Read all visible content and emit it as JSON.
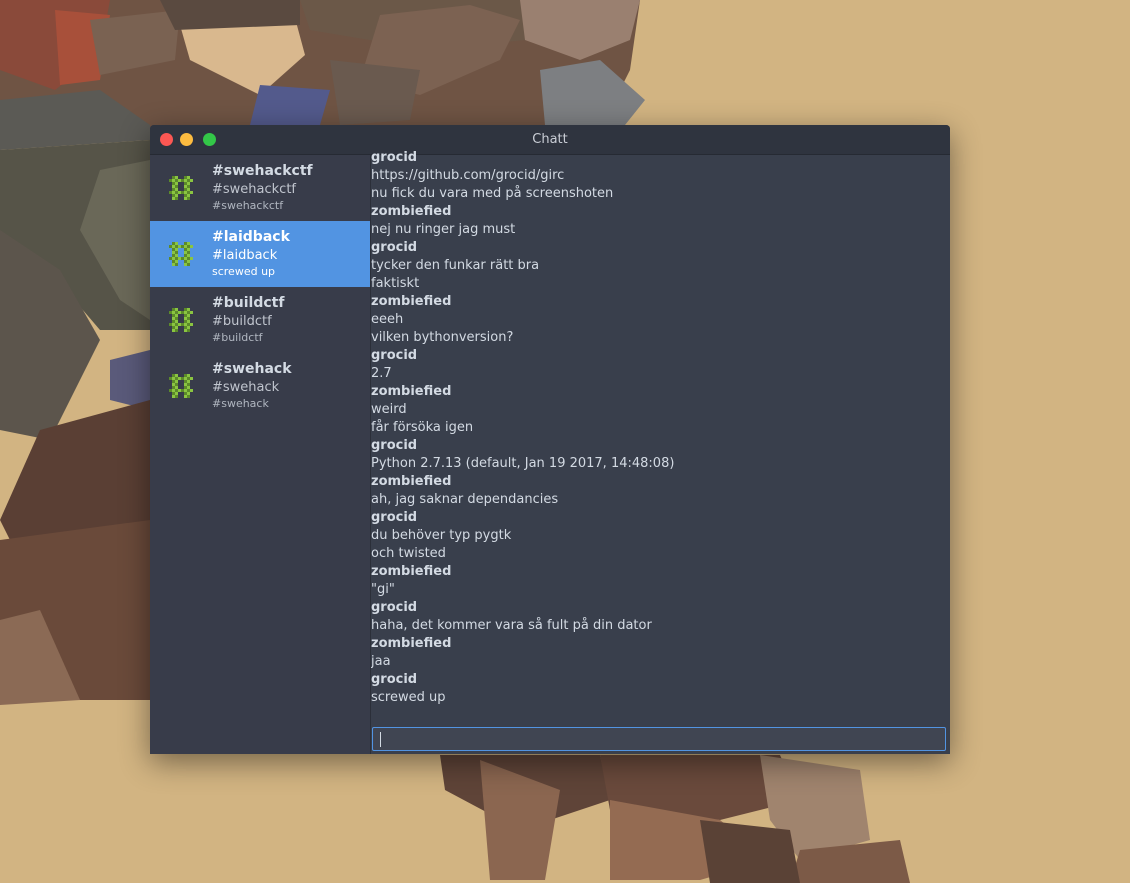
{
  "window": {
    "title": "Chatt"
  },
  "colors": {
    "accent": "#5294e2",
    "icon_green": "#8ac541",
    "window_bg": "#393f4c"
  },
  "sidebar": {
    "channels": [
      {
        "name": "#swehackctf",
        "topic": "#swehackctf",
        "last": "#swehackctf",
        "icon": "hash-icon"
      },
      {
        "name": "#laidback",
        "topic": "#laidback",
        "last": "screwed up",
        "icon": "hash-icon",
        "active": true
      },
      {
        "name": "#buildctf",
        "topic": "#buildctf",
        "last": "#buildctf",
        "icon": "hash-icon"
      },
      {
        "name": "#swehack",
        "topic": "#swehack",
        "last": "#swehack",
        "icon": "hash-icon"
      }
    ]
  },
  "messages": [
    {
      "nick": "grocid",
      "lines": [
        "https://github.com/grocid/girc",
        "nu fick du vara med på screenshoten"
      ]
    },
    {
      "nick": "zombiefied",
      "lines": [
        "nej nu ringer jag must"
      ]
    },
    {
      "nick": "grocid",
      "lines": [
        "tycker den funkar rätt bra",
        "faktiskt"
      ]
    },
    {
      "nick": "zombiefied",
      "lines": [
        "eeeh",
        "vilken bythonversion?"
      ]
    },
    {
      "nick": "grocid",
      "lines": [
        "2.7"
      ]
    },
    {
      "nick": "zombiefied",
      "lines": [
        "weird",
        "får försöka igen"
      ]
    },
    {
      "nick": "grocid",
      "lines": [
        "Python 2.7.13 (default, Jan 19 2017, 14:48:08)"
      ]
    },
    {
      "nick": "zombiefied",
      "lines": [
        "ah, jag saknar dependancies"
      ]
    },
    {
      "nick": "grocid",
      "lines": [
        "du behöver typ pygtk",
        "och twisted"
      ]
    },
    {
      "nick": "zombiefied",
      "lines": [
        "\"gi\""
      ]
    },
    {
      "nick": "grocid",
      "lines": [
        "haha, det kommer vara så fult på din dator"
      ]
    },
    {
      "nick": "zombiefied",
      "lines": [
        "jaa"
      ]
    },
    {
      "nick": "grocid",
      "lines": [
        "screwed up"
      ]
    }
  ],
  "input": {
    "value": ""
  }
}
